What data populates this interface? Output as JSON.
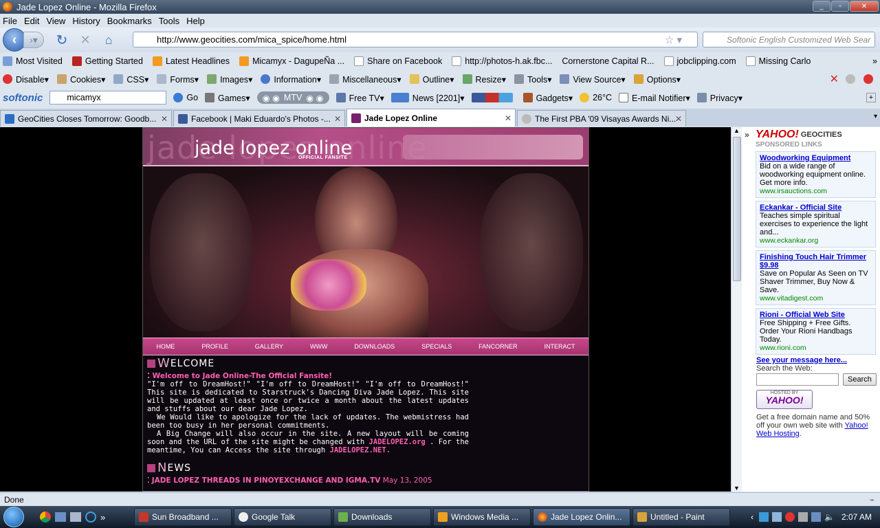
{
  "window": {
    "title": "Jade Lopez Online - Mozilla Firefox"
  },
  "menu": [
    "File",
    "Edit",
    "View",
    "History",
    "Bookmarks",
    "Tools",
    "Help"
  ],
  "nav": {
    "url": "http://www.geocities.com/mica_spice/home.html",
    "search_placeholder": "Softonic English Customized Web Sear"
  },
  "bookmarks": [
    "Most Visited",
    "Getting Started",
    "Latest Headlines",
    "Micamyx - DagupeÑa ...",
    "Share on Facebook",
    "http://photos-h.ak.fbc...",
    "Cornerstone Capital R...",
    "jobclipping.com",
    "Missing Carlo"
  ],
  "webdev": [
    "Disable▾",
    "Cookies▾",
    "CSS▾",
    "Forms▾",
    "Images▾",
    "Information▾",
    "Miscellaneous▾",
    "Outline▾",
    "Resize▾",
    "Tools▾",
    "View Source▾",
    "Options▾"
  ],
  "softonic": {
    "logo": "softonic",
    "query": "micamyx",
    "go": "Go",
    "games": "Games▾",
    "radio": "MTV",
    "freetv": "Free TV▾",
    "news": "News [2201]▾",
    "gadgets": "Gadgets▾",
    "weather": "26°C",
    "email": "E-mail Notifier▾",
    "privacy": "Privacy▾"
  },
  "tabs": [
    {
      "label": "GeoCities Closes Tomorrow: Goodb..."
    },
    {
      "label": "Facebook | Maki Eduardo's Photos -..."
    },
    {
      "label": "Jade Lopez Online"
    },
    {
      "label": "The First PBA '09 Visayas Awards Ni..."
    }
  ],
  "site": {
    "ghost": "jade lopez online",
    "logo": "jade lopez online",
    "tagline": "OFFICIAL FANSITE",
    "nav": [
      "HOME",
      "PROFILE",
      "GALLERY",
      "WWW",
      "DOWNLOADS",
      "SPECIALS",
      "FANCORNER",
      "INTERACT"
    ],
    "welcome_cap": "W",
    "welcome_rest": "ELCOME",
    "welcome_sub": "Welcome to Jade Online-The Official Fansite!",
    "p1": "\"I'm off to DreamHost!\" \"I'm off to DreamHost!\" \"I'm off to DreamHost!\" This site is dedicated to Starstruck's Dancing Diva Jade Lopez. This site will be updated at least once or twice a month about the latest updates and stuffs about our dear Jade Lopez.",
    "p2": "We Would like to apologize for the lack of updates. The webmistress had been too busy in her personal commitments.",
    "p3a": "A Big Change will also occur in the site. A new layout will be coming soon and the URL of the site might be changed with ",
    "p3_link1": "JADELOPEZ.org",
    "p3b": " . For the meantime, You can Access the site through ",
    "p3_link2": "JADELOPEZ.NET.",
    "news_cap": "N",
    "news_rest": "EWS",
    "news_item": "JADE LOPEZ THREADS IN PINOYEXCHANGE AND IGMA.TV",
    "news_date": "May 13, 2005"
  },
  "sidebar": {
    "brand_yahoo": "YAHOO!",
    "brand_geo": "GEOCITIES",
    "sponsored": "SPONSORED LINKS",
    "ads": [
      {
        "title": "Woodworking Equipment",
        "text": "Bid on a wide range of woodworking equipment online. Get more info.",
        "url": "www.irsauctions.com"
      },
      {
        "title": "Eckankar - Official Site",
        "text": "Teaches simple spiritual exercises to experience the light and...",
        "url": "www.eckankar.org"
      },
      {
        "title": "Finishing Touch Hair Trimmer $9.98",
        "text": "Save on Popular As Seen on TV Shaver Trimmer, Buy Now & Save.",
        "url": "www.vitadigest.com"
      },
      {
        "title": "Rioni - Official Web Site",
        "text": "Free Shipping + Free Gifts. Order Your Rioni Handbags Today.",
        "url": "www.rioni.com"
      }
    ],
    "see_message": "See your message here...",
    "search_label": "Search the Web:",
    "search_button": "Search",
    "hosted_by": "HOSTED BY",
    "hosted_yahoo": "YAHOO!",
    "promo": "Get a free domain name and 50% off your own web site with ",
    "promo_link": "Yahoo! Web Hosting",
    "promo_end": "."
  },
  "status": "Done",
  "taskbar": {
    "buttons": [
      "Sun Broadband ...",
      "Google Talk",
      "Downloads",
      "Windows Media ...",
      "Jade Lopez Onlin...",
      "Untitled - Paint"
    ],
    "clock": "2:07 AM"
  }
}
